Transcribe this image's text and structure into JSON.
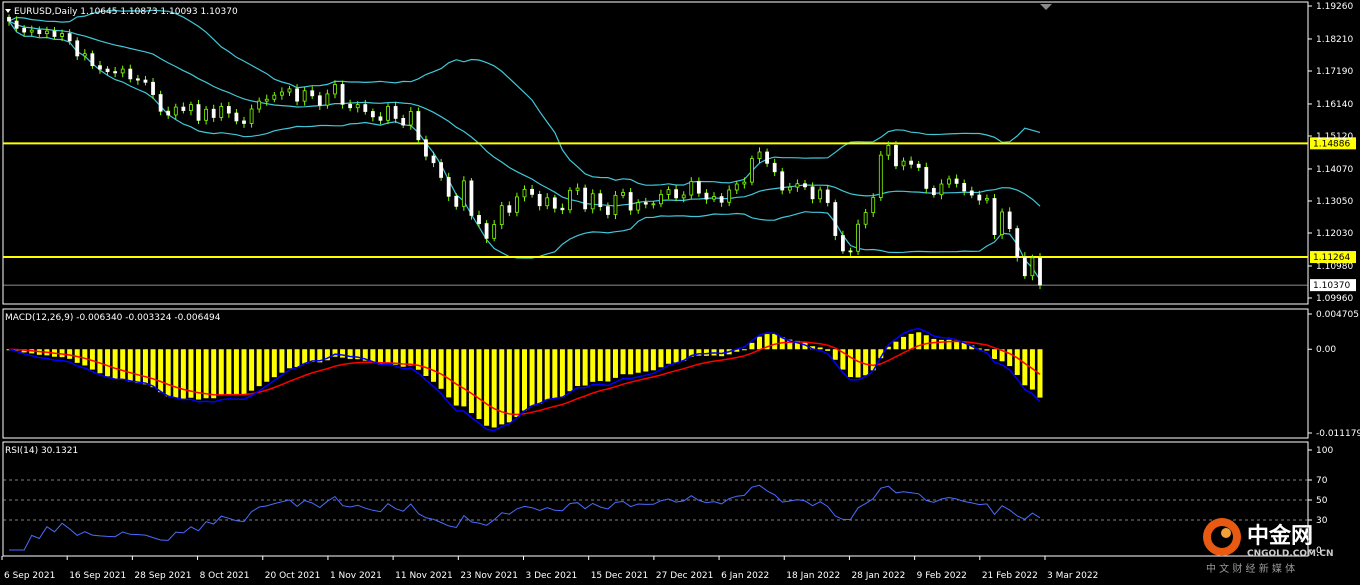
{
  "chart_data": [
    {
      "type": "candlestick",
      "symbol": "EURUSD",
      "timeframe": "Daily",
      "header_ohlc": [
        "1.10645",
        "1.10873",
        "1.10093",
        "1.10370"
      ],
      "y_ticks": [
        "1.19260",
        "1.18210",
        "1.17190",
        "1.16140",
        "1.15120",
        "1.14070",
        "1.13050",
        "1.12030",
        "1.10980",
        "1.09960"
      ],
      "y_tick_values": [
        1.1926,
        1.1821,
        1.1719,
        1.1614,
        1.1512,
        1.1407,
        1.1305,
        1.1203,
        1.1098,
        1.0996
      ],
      "ylim": [
        1.0996,
        1.1926
      ],
      "x_labels": [
        "6 Sep 2021",
        "16 Sep 2021",
        "28 Sep 2021",
        "8 Oct 2021",
        "20 Oct 2021",
        "1 Nov 2021",
        "11 Nov 2021",
        "23 Nov 2021",
        "3 Dec 2021",
        "15 Dec 2021",
        "27 Dec 2021",
        "6 Jan 2022",
        "18 Jan 2022",
        "28 Jan 2022",
        "9 Feb 2022",
        "21 Feb 2022",
        "3 Mar 2022"
      ],
      "horizontal_levels": [
        {
          "value": 1.14886,
          "label": "1.14886",
          "color": "#ffff00"
        },
        {
          "value": 1.11264,
          "label": "1.11264",
          "color": "#ffff00"
        }
      ],
      "current_price": {
        "value": 1.1037,
        "label": "1.10370"
      },
      "candle_color": "#7fff00",
      "band_color": "#40c8d8",
      "closes": [
        1.1878,
        1.1855,
        1.1843,
        1.1849,
        1.1838,
        1.1846,
        1.1829,
        1.1838,
        1.1815,
        1.1767,
        1.1774,
        1.1736,
        1.1725,
        1.1717,
        1.1713,
        1.1725,
        1.1694,
        1.169,
        1.1683,
        1.1644,
        1.1591,
        1.1579,
        1.1604,
        1.1593,
        1.1612,
        1.1562,
        1.1597,
        1.1571,
        1.1606,
        1.1585,
        1.156,
        1.1552,
        1.1598,
        1.1623,
        1.1629,
        1.1642,
        1.1652,
        1.1662,
        1.1623,
        1.1656,
        1.164,
        1.161,
        1.1646,
        1.1676,
        1.1613,
        1.1602,
        1.1612,
        1.159,
        1.1573,
        1.1562,
        1.1606,
        1.1568,
        1.1547,
        1.159,
        1.15,
        1.1448,
        1.1427,
        1.138,
        1.132,
        1.1288,
        1.1369,
        1.1259,
        1.1233,
        1.1186,
        1.123,
        1.129,
        1.1269,
        1.1318,
        1.1342,
        1.1326,
        1.129,
        1.1315,
        1.1282,
        1.1277,
        1.1339,
        1.1346,
        1.128,
        1.1328,
        1.1287,
        1.1262,
        1.1323,
        1.1332,
        1.1276,
        1.13,
        1.1295,
        1.1296,
        1.1326,
        1.1341,
        1.1315,
        1.1324,
        1.1367,
        1.133,
        1.1311,
        1.1319,
        1.1301,
        1.134,
        1.1359,
        1.1365,
        1.144,
        1.1461,
        1.1425,
        1.1398,
        1.134,
        1.1349,
        1.136,
        1.135,
        1.1312,
        1.134,
        1.13,
        1.1195,
        1.1146,
        1.1145,
        1.1231,
        1.1268,
        1.1316,
        1.1451,
        1.1482,
        1.1417,
        1.1432,
        1.1422,
        1.1412,
        1.1345,
        1.1325,
        1.1359,
        1.1375,
        1.1361,
        1.1337,
        1.1324,
        1.1308,
        1.1313,
        1.1198,
        1.127,
        1.1217,
        1.1127,
        1.1067,
        1.1124,
        1.1037
      ],
      "indicators": [
        {
          "name": "MACD",
          "params": "12,26,9",
          "values": [
            "-0.006340",
            "-0.003324",
            "-0.006494"
          ],
          "y_ticks": [
            "0.004705",
            "0.00",
            "-0.011179"
          ],
          "ylim": [
            -0.011179,
            0.004705
          ],
          "histogram_color": "#ffff00",
          "macd_color": "#0000ff",
          "signal_color": "#ff0000"
        },
        {
          "name": "RSI",
          "params": "14",
          "values": [
            "30.1321"
          ],
          "y_ticks": [
            "100",
            "70",
            "50",
            "30",
            "0"
          ],
          "ylim": [
            0,
            100
          ],
          "line_color": "#4a6cff"
        }
      ]
    }
  ],
  "watermark": {
    "text": "中金网",
    "sub": "CNGOLD.COM.CN",
    "tagline": "中 文 财 经 新 媒 体"
  }
}
